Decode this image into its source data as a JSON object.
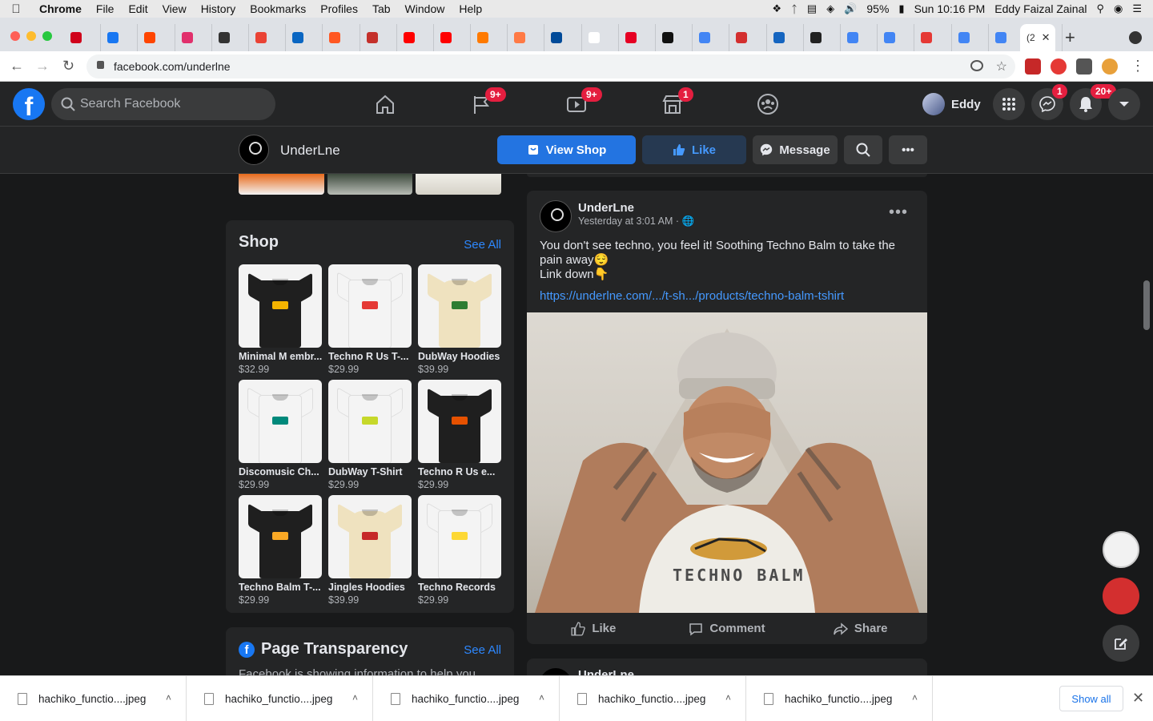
{
  "mac_menu": {
    "app": "Chrome",
    "items": [
      "File",
      "Edit",
      "View",
      "History",
      "Bookmarks",
      "Profiles",
      "Tab",
      "Window",
      "Help"
    ],
    "battery": "95%",
    "clock": "Sun 10:16 PM",
    "user": "Eddy Faizal Zainal"
  },
  "browser": {
    "tab_fav_colors": [
      "#d0021b",
      "#1877f2",
      "#ff4500",
      "#e1306c",
      "#333333",
      "#ea4335",
      "#0a66c2",
      "#ff5722",
      "#c4302b",
      "#ff0000",
      "#ff0000",
      "#ff7a00",
      "#ff7a45",
      "#004a99",
      "#ffffff",
      "#e60023",
      "#111111",
      "#4285f4",
      "#d32f2f",
      "#1565c0",
      "#222222",
      "#4285f4",
      "#4285f4",
      "#e53935",
      "#4285f4",
      "#4285f4",
      "#555555"
    ],
    "active_tab_title": "(2",
    "url": "facebook.com/underlne"
  },
  "fb": {
    "search_placeholder": "Search Facebook",
    "badges": {
      "pages": "9+",
      "watch": "9+",
      "marketplace": "1",
      "messenger": "1",
      "notifications": "20+"
    },
    "profile_name": "Eddy"
  },
  "page": {
    "name": "UnderLne",
    "view_shop": "View Shop",
    "like": "Like",
    "message": "Message"
  },
  "shop": {
    "title": "Shop",
    "see_all": "See All",
    "products": [
      {
        "name": "Minimal M embr...",
        "price": "$32.99",
        "kind": "tee",
        "color": "#1f1f1f",
        "mark": "#f5b400"
      },
      {
        "name": "Techno R Us T-...",
        "price": "$29.99",
        "kind": "tee",
        "color": "#f4f4f4",
        "mark": "#e53935"
      },
      {
        "name": "DubWay Hoodies",
        "price": "$39.99",
        "kind": "hoodie",
        "color": "#efe2bf",
        "mark": "#2e7d32"
      },
      {
        "name": "Discomusic Ch...",
        "price": "$29.99",
        "kind": "tee",
        "color": "#f4f4f4",
        "mark": "#00897b"
      },
      {
        "name": "DubWay T-Shirt",
        "price": "$29.99",
        "kind": "tee",
        "color": "#f4f4f4",
        "mark": "#c6d82a"
      },
      {
        "name": "Techno R Us e...",
        "price": "$29.99",
        "kind": "tee",
        "color": "#1f1f1f",
        "mark": "#e65100"
      },
      {
        "name": "Techno Balm T-...",
        "price": "$29.99",
        "kind": "tee",
        "color": "#1f1f1f",
        "mark": "#f9a825"
      },
      {
        "name": "Jingles Hoodies",
        "price": "$39.99",
        "kind": "hoodie",
        "color": "#efe2bf",
        "mark": "#c62828"
      },
      {
        "name": "Techno Records",
        "price": "$29.99",
        "kind": "tee",
        "color": "#f4f4f4",
        "mark": "#fdd835"
      }
    ]
  },
  "transparency": {
    "title": "Page Transparency",
    "see_all": "See All",
    "text": "Facebook is showing information to help you"
  },
  "post": {
    "author": "UnderLne",
    "time": "Yesterday at 3:01 AM · ",
    "text_line1": "You don't see techno, you feel it! Soothing Techno Balm to take the pain away😌",
    "text_line2": "Link down👇",
    "link": "https://underlne.com/.../t-sh.../products/techno-balm-tshirt",
    "photo_text": "TECHNO BALM",
    "actions": {
      "like": "Like",
      "comment": "Comment",
      "share": "Share"
    }
  },
  "next_post": {
    "author": "UnderLne"
  },
  "downloads": {
    "files": [
      "hachiko_functio....jpeg",
      "hachiko_functio....jpeg",
      "hachiko_functio....jpeg",
      "hachiko_functio....jpeg",
      "hachiko_functio....jpeg"
    ],
    "show_all": "Show all"
  }
}
